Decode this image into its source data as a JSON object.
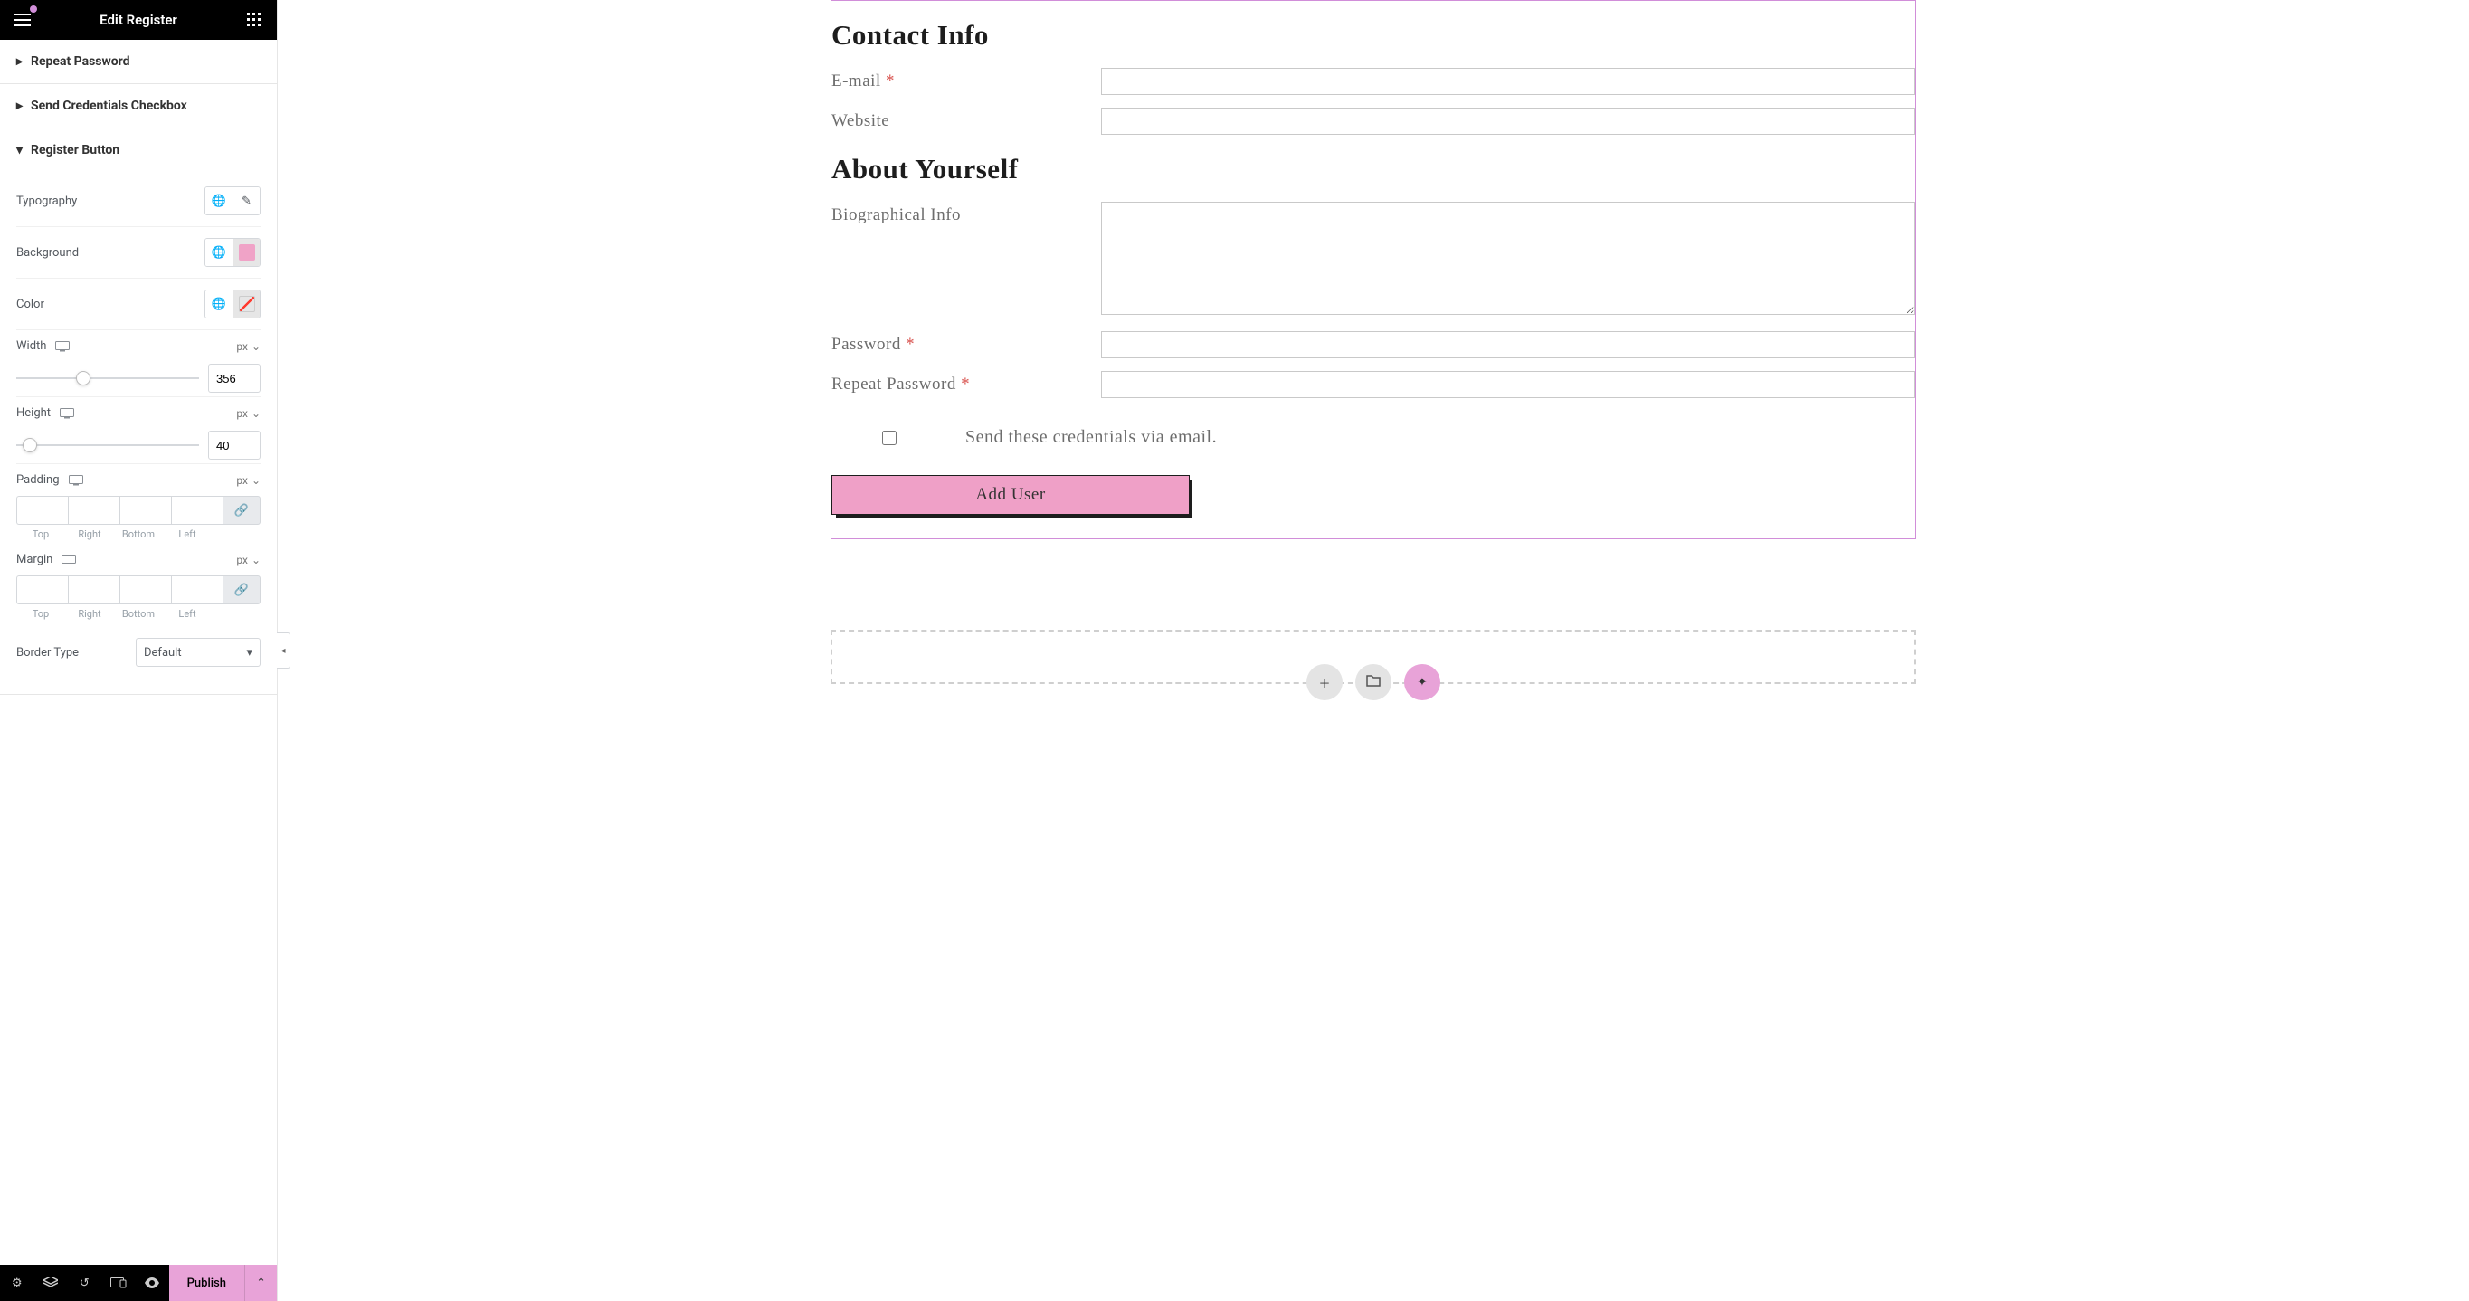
{
  "header": {
    "title": "Edit Register"
  },
  "sections": {
    "repeat_password": {
      "title": "Repeat Password"
    },
    "send_credentials": {
      "title": "Send Credentials Checkbox"
    },
    "register_button": {
      "title": "Register Button"
    }
  },
  "controls": {
    "typography": {
      "label": "Typography"
    },
    "background": {
      "label": "Background",
      "swatch": "#f0a3c7"
    },
    "color": {
      "label": "Color"
    },
    "width": {
      "label": "Width",
      "unit": "px",
      "value": "356"
    },
    "height": {
      "label": "Height",
      "unit": "px",
      "value": "40"
    },
    "padding": {
      "label": "Padding",
      "unit": "px",
      "top": "",
      "right": "",
      "bottom": "",
      "left": "",
      "side_labels": {
        "top": "Top",
        "right": "Right",
        "bottom": "Bottom",
        "left": "Left"
      }
    },
    "margin": {
      "label": "Margin",
      "unit": "px",
      "top": "",
      "right": "",
      "bottom": "",
      "left": "",
      "side_labels": {
        "top": "Top",
        "right": "Right",
        "bottom": "Bottom",
        "left": "Left"
      }
    },
    "border_type": {
      "label": "Border Type",
      "value": "Default"
    }
  },
  "footer": {
    "publish": "Publish"
  },
  "preview": {
    "contact_title": "Contact Info",
    "email_label": "E-mail",
    "website_label": "Website",
    "about_title": "About Yourself",
    "bio_label": "Biographical Info",
    "password_label": "Password",
    "repeat_password_label": "Repeat Password",
    "checkbox_label": "Send these credentials via email.",
    "submit_label": "Add User",
    "required_mark": "*"
  }
}
